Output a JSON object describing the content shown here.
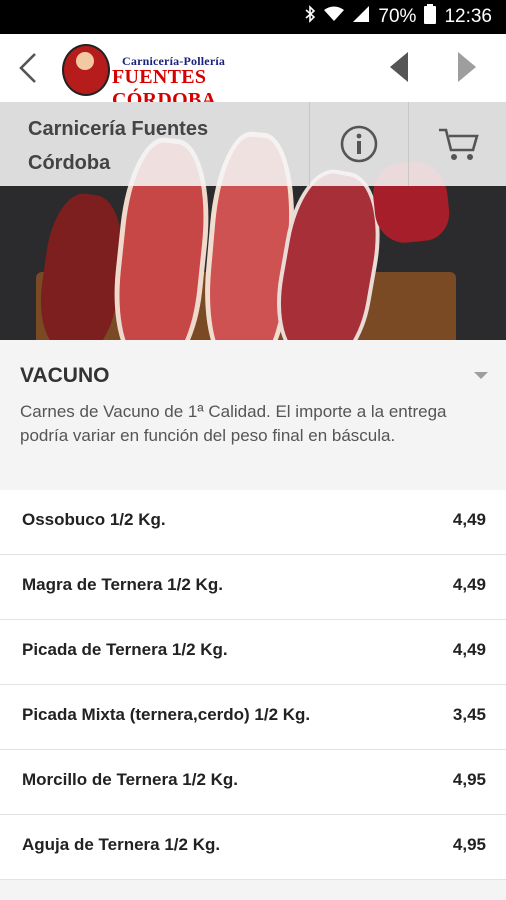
{
  "status_bar": {
    "battery_percent": "70%",
    "time": "12:36",
    "icons": [
      "bluetooth-icon",
      "wifi-icon",
      "signal-icon",
      "battery-icon"
    ]
  },
  "app_bar": {
    "logo_line1": "Carnicería-Pollería",
    "logo_line2": "FUENTES CÓRDOBA",
    "icons": [
      "back-arrow-icon",
      "prev-triangle-icon",
      "next-triangle-icon"
    ]
  },
  "shop": {
    "name_line1": "Carnicería Fuentes",
    "name_line2": "Córdoba",
    "icons": [
      "info-icon",
      "cart-icon"
    ]
  },
  "category": {
    "title": "VACUNO",
    "description": "Carnes de Vacuno de 1ª Calidad. El importe a la entrega podría variar en función del peso final en báscula."
  },
  "products": [
    {
      "name": "Ossobuco 1/2 Kg.",
      "price": "4,49"
    },
    {
      "name": "Magra de Ternera 1/2 Kg.",
      "price": "4,49"
    },
    {
      "name": "Picada de Ternera 1/2 Kg.",
      "price": "4,49"
    },
    {
      "name": "Picada Mixta (ternera,cerdo) 1/2 Kg.",
      "price": "3,45"
    },
    {
      "name": "Morcillo de Ternera 1/2 Kg.",
      "price": "4,95"
    },
    {
      "name": "Aguja de Ternera 1/2 Kg.",
      "price": "4,95"
    }
  ],
  "colors": {
    "logo_red": "#d50000",
    "logo_blue": "#1a237e",
    "background": "#f4f4f4"
  }
}
